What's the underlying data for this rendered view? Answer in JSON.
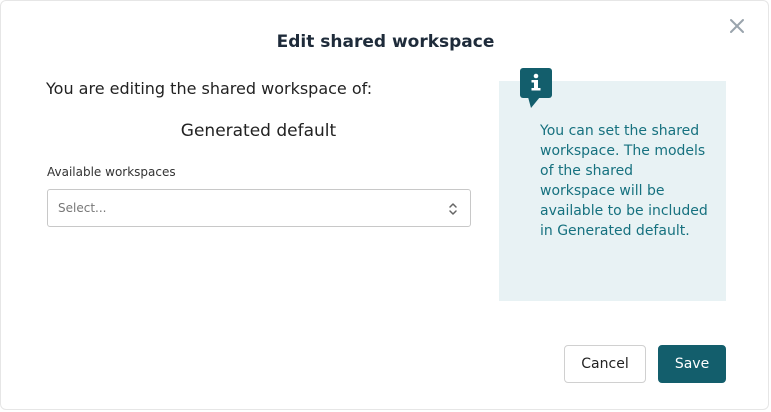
{
  "dialog": {
    "title": "Edit shared workspace",
    "intro": "You are editing the shared workspace of:",
    "target_name": "Generated default",
    "field": {
      "label": "Available workspaces",
      "placeholder": "Select..."
    },
    "info": {
      "icon": "info-icon",
      "text": "You can set the shared workspace. The models of the shared workspace will be available to be included in Generated default."
    },
    "buttons": {
      "cancel": "Cancel",
      "save": "Save"
    },
    "colors": {
      "accent": "#135e6c",
      "info_background": "#e8f2f4",
      "info_text": "#16717f"
    }
  }
}
